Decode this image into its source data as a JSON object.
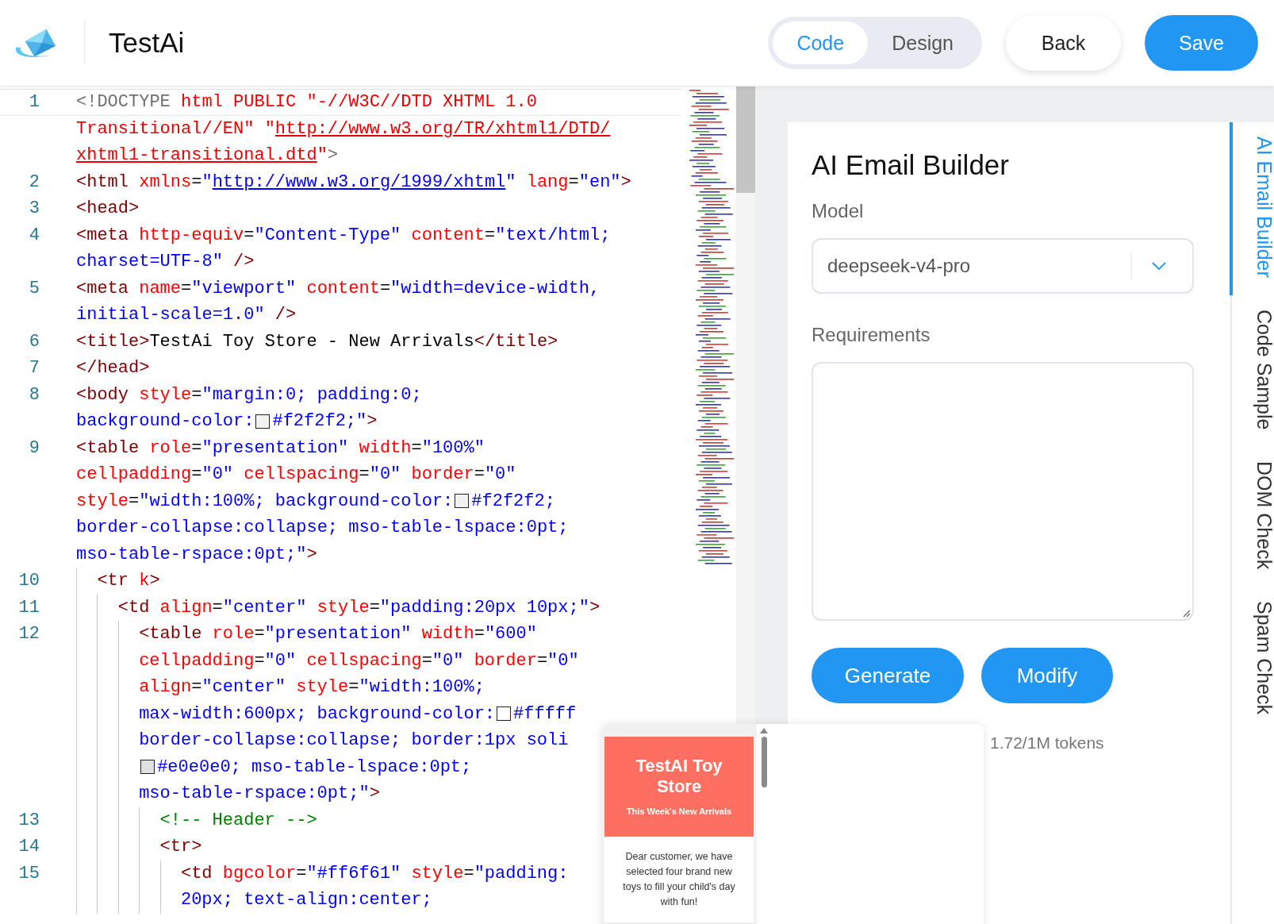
{
  "header": {
    "app_name": "TestAi",
    "view_toggle": [
      {
        "label": "Code",
        "selected": true
      },
      {
        "label": "Design",
        "selected": false
      }
    ],
    "buttons": [
      {
        "label": "Back",
        "kind": "secondary"
      },
      {
        "label": "Save",
        "kind": "primary"
      }
    ]
  },
  "editor": {
    "lines": [
      {
        "number": "1",
        "rows": [
          {
            "segments": [
              {
                "kind": "doctype",
                "text": "<!DOCTYPE "
              },
              {
                "kind": "docstr",
                "text": "html PUBLIC \"-//W3C//DTD XHTML 1.0"
              }
            ]
          },
          {
            "segments": [
              {
                "kind": "docstr",
                "text": "Transitional//EN\" \""
              },
              {
                "kind": "doclink",
                "text": "http://www.w3.org/TR/xhtml1/DTD/"
              }
            ]
          },
          {
            "segments": [
              {
                "kind": "doclink",
                "text": "xhtml1-transitional.dtd"
              },
              {
                "kind": "docstr",
                "text": "\""
              },
              {
                "kind": "doctype",
                "text": ">"
              }
            ]
          }
        ]
      },
      {
        "number": "2",
        "rows": [
          {
            "segments": [
              {
                "kind": "tag",
                "text": "<html "
              },
              {
                "kind": "attr",
                "text": "xmlns"
              },
              {
                "kind": "eq",
                "text": "="
              },
              {
                "kind": "str",
                "text": "\""
              },
              {
                "kind": "link",
                "text": "http://www.w3.org/1999/xhtml"
              },
              {
                "kind": "str",
                "text": "\" "
              },
              {
                "kind": "attr",
                "text": "lang"
              },
              {
                "kind": "eq",
                "text": "="
              },
              {
                "kind": "str",
                "text": "\"en\""
              },
              {
                "kind": "tag",
                "text": ">"
              }
            ]
          }
        ]
      },
      {
        "number": "3",
        "rows": [
          {
            "segments": [
              {
                "kind": "tag",
                "text": "<head>"
              }
            ]
          }
        ]
      },
      {
        "number": "4",
        "rows": [
          {
            "segments": [
              {
                "kind": "tag",
                "text": "<meta "
              },
              {
                "kind": "attr",
                "text": "http-equiv"
              },
              {
                "kind": "eq",
                "text": "="
              },
              {
                "kind": "str",
                "text": "\"Content-Type\" "
              },
              {
                "kind": "attr",
                "text": "content"
              },
              {
                "kind": "eq",
                "text": "="
              },
              {
                "kind": "str",
                "text": "\"text/html;"
              }
            ]
          },
          {
            "segments": [
              {
                "kind": "str",
                "text": "charset=UTF-8\" "
              },
              {
                "kind": "tag",
                "text": "/>"
              }
            ]
          }
        ]
      },
      {
        "number": "5",
        "rows": [
          {
            "segments": [
              {
                "kind": "tag",
                "text": "<meta "
              },
              {
                "kind": "attr",
                "text": "name"
              },
              {
                "kind": "eq",
                "text": "="
              },
              {
                "kind": "str",
                "text": "\"viewport\" "
              },
              {
                "kind": "attr",
                "text": "content"
              },
              {
                "kind": "eq",
                "text": "="
              },
              {
                "kind": "str",
                "text": "\"width=device-width,"
              }
            ]
          },
          {
            "segments": [
              {
                "kind": "str",
                "text": "initial-scale=1.0\" "
              },
              {
                "kind": "tag",
                "text": "/>"
              }
            ]
          }
        ]
      },
      {
        "number": "6",
        "rows": [
          {
            "segments": [
              {
                "kind": "tag",
                "text": "<title>"
              },
              {
                "kind": "text",
                "text": "TestAi Toy Store - New Arrivals"
              },
              {
                "kind": "tag",
                "text": "</title>"
              }
            ]
          }
        ]
      },
      {
        "number": "7",
        "rows": [
          {
            "segments": [
              {
                "kind": "tag",
                "text": "</head>"
              }
            ]
          }
        ]
      },
      {
        "number": "8",
        "rows": [
          {
            "segments": [
              {
                "kind": "tag",
                "text": "<body "
              },
              {
                "kind": "attr",
                "text": "style"
              },
              {
                "kind": "eq",
                "text": "="
              },
              {
                "kind": "str",
                "text": "\"margin:0; padding:0;"
              }
            ]
          },
          {
            "segments": [
              {
                "kind": "str",
                "text": "background-color:"
              },
              {
                "kind": "swatch",
                "color": "#f2f2f2"
              },
              {
                "kind": "str",
                "text": "#f2f2f2;\""
              },
              {
                "kind": "tag",
                "text": ">"
              }
            ]
          }
        ]
      },
      {
        "number": "9",
        "rows": [
          {
            "segments": [
              {
                "kind": "tag",
                "text": "<table "
              },
              {
                "kind": "attr",
                "text": "role"
              },
              {
                "kind": "eq",
                "text": "="
              },
              {
                "kind": "str",
                "text": "\"presentation\" "
              },
              {
                "kind": "attr",
                "text": "width"
              },
              {
                "kind": "eq",
                "text": "="
              },
              {
                "kind": "str",
                "text": "\"100%\""
              }
            ]
          },
          {
            "segments": [
              {
                "kind": "attr",
                "text": "cellpadding"
              },
              {
                "kind": "eq",
                "text": "="
              },
              {
                "kind": "str",
                "text": "\"0\" "
              },
              {
                "kind": "attr",
                "text": "cellspacing"
              },
              {
                "kind": "eq",
                "text": "="
              },
              {
                "kind": "str",
                "text": "\"0\" "
              },
              {
                "kind": "attr",
                "text": "border"
              },
              {
                "kind": "eq",
                "text": "="
              },
              {
                "kind": "str",
                "text": "\"0\""
              }
            ]
          },
          {
            "segments": [
              {
                "kind": "attr",
                "text": "style"
              },
              {
                "kind": "eq",
                "text": "="
              },
              {
                "kind": "str",
                "text": "\"width:100%; background-color:"
              },
              {
                "kind": "swatch",
                "color": "#f2f2f2"
              },
              {
                "kind": "str",
                "text": "#f2f2f2;"
              }
            ]
          },
          {
            "segments": [
              {
                "kind": "str",
                "text": "border-collapse:collapse; mso-table-lspace:0pt;"
              }
            ]
          },
          {
            "segments": [
              {
                "kind": "str",
                "text": "mso-table-rspace:0pt;\""
              },
              {
                "kind": "tag",
                "text": ">"
              }
            ]
          }
        ],
        "children": [
          {
            "number": "10",
            "rows": [
              {
                "segments": [
                  {
                    "kind": "tag",
                    "text": "<tr "
                  },
                  {
                    "kind": "attr",
                    "text": "k"
                  },
                  {
                    "kind": "tag",
                    "text": ">"
                  }
                ]
              }
            ],
            "children": [
              {
                "number": "11",
                "rows": [
                  {
                    "segments": [
                      {
                        "kind": "tag",
                        "text": "<td "
                      },
                      {
                        "kind": "attr",
                        "text": "align"
                      },
                      {
                        "kind": "eq",
                        "text": "="
                      },
                      {
                        "kind": "str",
                        "text": "\"center\" "
                      },
                      {
                        "kind": "attr",
                        "text": "style"
                      },
                      {
                        "kind": "eq",
                        "text": "="
                      },
                      {
                        "kind": "str",
                        "text": "\"padding:20px 10px;\""
                      },
                      {
                        "kind": "tag",
                        "text": ">"
                      }
                    ]
                  }
                ],
                "children": [
                  {
                    "number": "12",
                    "rows": [
                      {
                        "segments": [
                          {
                            "kind": "tag",
                            "text": "<table "
                          },
                          {
                            "kind": "attr",
                            "text": "role"
                          },
                          {
                            "kind": "eq",
                            "text": "="
                          },
                          {
                            "kind": "str",
                            "text": "\"presentation\" "
                          },
                          {
                            "kind": "attr",
                            "text": "width"
                          },
                          {
                            "kind": "eq",
                            "text": "="
                          },
                          {
                            "kind": "str",
                            "text": "\"600\""
                          }
                        ]
                      },
                      {
                        "segments": [
                          {
                            "kind": "attr",
                            "text": "cellpadding"
                          },
                          {
                            "kind": "eq",
                            "text": "="
                          },
                          {
                            "kind": "str",
                            "text": "\"0\" "
                          },
                          {
                            "kind": "attr",
                            "text": "cellspacing"
                          },
                          {
                            "kind": "eq",
                            "text": "="
                          },
                          {
                            "kind": "str",
                            "text": "\"0\" "
                          },
                          {
                            "kind": "attr",
                            "text": "border"
                          },
                          {
                            "kind": "eq",
                            "text": "="
                          },
                          {
                            "kind": "str",
                            "text": "\"0\""
                          }
                        ]
                      },
                      {
                        "segments": [
                          {
                            "kind": "attr",
                            "text": "align"
                          },
                          {
                            "kind": "eq",
                            "text": "="
                          },
                          {
                            "kind": "str",
                            "text": "\"center\" "
                          },
                          {
                            "kind": "attr",
                            "text": "style"
                          },
                          {
                            "kind": "eq",
                            "text": "="
                          },
                          {
                            "kind": "str",
                            "text": "\"width:100%;"
                          }
                        ]
                      },
                      {
                        "segments": [
                          {
                            "kind": "str",
                            "text": "max-width:600px; background-color:"
                          },
                          {
                            "kind": "swatch",
                            "color": "#ffffff"
                          },
                          {
                            "kind": "str",
                            "text": "#fffff"
                          }
                        ]
                      },
                      {
                        "segments": [
                          {
                            "kind": "str",
                            "text": "border-collapse:collapse; border:1px soli"
                          }
                        ]
                      },
                      {
                        "segments": [
                          {
                            "kind": "swatch",
                            "color": "#e0e0e0"
                          },
                          {
                            "kind": "str",
                            "text": "#e0e0e0; mso-table-lspace:0pt;"
                          }
                        ]
                      },
                      {
                        "segments": [
                          {
                            "kind": "str",
                            "text": "mso-table-rspace:0pt;\""
                          },
                          {
                            "kind": "tag",
                            "text": ">"
                          }
                        ]
                      }
                    ],
                    "children": [
                      {
                        "number": "13",
                        "rows": [
                          {
                            "segments": [
                              {
                                "kind": "comment",
                                "text": "<!-- Header -->"
                              }
                            ]
                          }
                        ]
                      },
                      {
                        "number": "14",
                        "rows": [
                          {
                            "segments": [
                              {
                                "kind": "tag",
                                "text": "<tr>"
                              }
                            ]
                          }
                        ],
                        "children": [
                          {
                            "number": "15",
                            "rows": [
                              {
                                "segments": [
                                  {
                                    "kind": "tag",
                                    "text": "<td "
                                  },
                                  {
                                    "kind": "attr",
                                    "text": "bgcolor"
                                  },
                                  {
                                    "kind": "eq",
                                    "text": "="
                                  },
                                  {
                                    "kind": "str",
                                    "text": "\"#ff6f61\" "
                                  },
                                  {
                                    "kind": "attr",
                                    "text": "style"
                                  },
                                  {
                                    "kind": "eq",
                                    "text": "="
                                  },
                                  {
                                    "kind": "str",
                                    "text": "\"padding:"
                                  }
                                ]
                              },
                              {
                                "segments": [
                                  {
                                    "kind": "str",
                                    "text": "20px; text-align:center;"
                                  }
                                ]
                              }
                            ]
                          }
                        ]
                      }
                    ]
                  }
                ]
              }
            ]
          }
        ]
      }
    ]
  },
  "builder": {
    "title": "AI Email Builder",
    "model_label": "Model",
    "model_value": "deepseek-v4-pro",
    "requirements_label": "Requirements",
    "actions": [
      "Generate",
      "Modify"
    ],
    "token_usage": "1.72/1M tokens"
  },
  "side_tabs": [
    {
      "label": "AI Email Builder",
      "selected": true
    },
    {
      "label": "Code Sample",
      "selected": false
    },
    {
      "label": "DOM Check",
      "selected": false
    },
    {
      "label": "Spam Check",
      "selected": false
    }
  ],
  "preview": {
    "heading": "TestAI Toy Store",
    "subheading": "This Week's New Arrivals",
    "body": "Dear customer, we have selected four brand new toys to fill your child's day with fun!"
  }
}
